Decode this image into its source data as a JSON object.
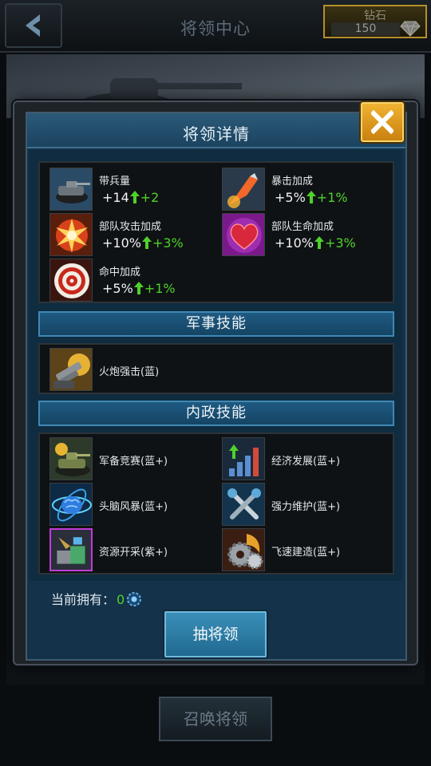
{
  "header": {
    "title": "将领中心",
    "diamond_label": "钻石",
    "diamond_value": "150"
  },
  "dialog": {
    "title": "将领详情",
    "stats": [
      {
        "label": "带兵量",
        "value": "+14",
        "bonus": "+2",
        "icon": "tank-icon"
      },
      {
        "label": "暴击加成",
        "value": "+5%",
        "bonus": "+1%",
        "icon": "missile-icon"
      },
      {
        "label": "部队攻击加成",
        "value": "+10%",
        "bonus": "+3%",
        "icon": "explosion-icon"
      },
      {
        "label": "部队生命加成",
        "value": "+10%",
        "bonus": "+3%",
        "icon": "heart-icon"
      },
      {
        "label": "命中加成",
        "value": "+5%",
        "bonus": "+1%",
        "icon": "target-icon"
      }
    ],
    "military_section": "军事技能",
    "military_skills": [
      {
        "name": "火炮强击(蓝)",
        "icon": "cannon-icon"
      }
    ],
    "civil_section": "内政技能",
    "civil_skills": [
      {
        "name": "军备竞赛(蓝+)",
        "icon": "arms-race-icon"
      },
      {
        "name": "经济发展(蓝+)",
        "icon": "economy-chart-icon"
      },
      {
        "name": "头脑风暴(蓝+)",
        "icon": "brain-icon"
      },
      {
        "name": "强力维护(蓝+)",
        "icon": "wrench-icon"
      },
      {
        "name": "资源开采(紫+)",
        "icon": "mining-icon"
      },
      {
        "name": "飞速建造(蓝+)",
        "icon": "gear-build-icon"
      }
    ],
    "owned_label": "当前拥有：",
    "owned_count": "0",
    "draw_button": "抽将领"
  },
  "bottom_button": "召唤将领",
  "colors": {
    "bonus_green": "#4fd12b",
    "close_gold": "#e8a524",
    "section_blue": "#1f5a82"
  }
}
